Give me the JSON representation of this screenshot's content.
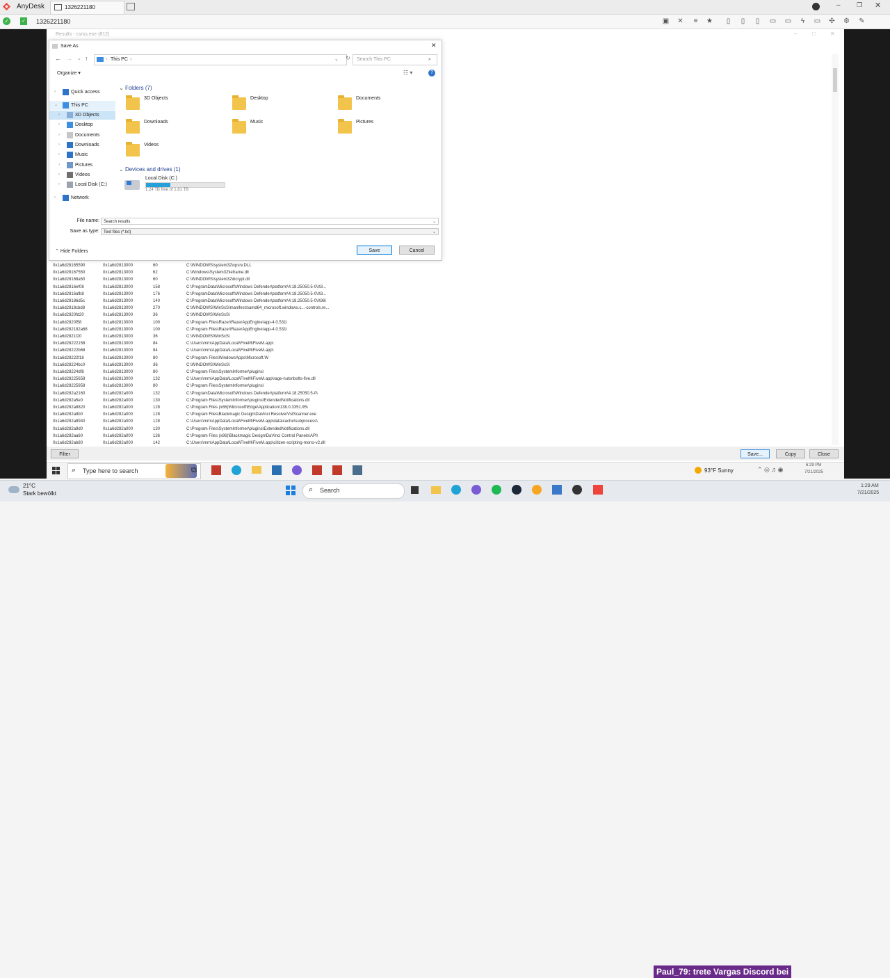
{
  "anydesk": {
    "app_name": "AnyDesk",
    "tab_label": "1326221180",
    "address_label": "1326221180",
    "brand_color": "#ef443b"
  },
  "results_window": {
    "title": "Results - csrss.exe (812)",
    "rows": [
      [
        "0x1a6d28165590",
        "0x1a6d2813000",
        "60",
        "C:\\WINDOWS\\system32\\xpsrv.DLL"
      ],
      [
        "0x1a6d28167550",
        "0x1a6d2813000",
        "62",
        "C:\\Windows\\System32\\ieframe.dll"
      ],
      [
        "0x1a6d28168a50",
        "0x1a6d2813000",
        "60",
        "C:\\WINDOWS\\system32\\bcrypt.dll"
      ],
      [
        "0x1a6d2816ef08",
        "0x1a6d2813000",
        "158",
        "C:\\ProgramData\\Microsoft\\Windows Defender\\platform\\4.18.25050.5-0\\X8..."
      ],
      [
        "0x1a6d2816afb8",
        "0x1a6d2813000",
        "176",
        "C:\\ProgramData\\Microsoft\\Windows Defender\\platform\\4.18.25050.5-0\\X8..."
      ],
      [
        "0x1a6d28186d5c",
        "0x1a6d2813000",
        "140",
        "C:\\ProgramData\\Microsoft\\Windows Defender\\platform\\4.18.25050.5-0\\X86\\"
      ],
      [
        "0x1a6d2818cbd8",
        "0x1a6d2813000",
        "270",
        "C:\\WINDOWS\\WinSxS\\manifests\\amd64_microsoft.windows.c...-controls.re..."
      ],
      [
        "0x1a6d2820fd20",
        "0x1a6d2813000",
        "36",
        "C:\\WINDOWS\\WinSxS\\"
      ],
      [
        "0x1a6d2820f58",
        "0x1a6d2813000",
        "100",
        "C:\\Program Files\\Razer\\RazerAppEngine\\app-4.0.531\\"
      ],
      [
        "0x1a6d282182a68",
        "0x1a6d2813000",
        "100",
        "C:\\Program Files\\Razer\\RazerAppEngine\\app-4.0.531\\"
      ],
      [
        "0x1a6d2821f20",
        "0x1a6d2813000",
        "36",
        "C:\\WINDOWS\\WinSxS\\"
      ],
      [
        "0x1a6d28222158",
        "0x1a6d2813000",
        "84",
        "C:\\Users\\mm\\AppData\\Local\\FiveM\\FiveM.app\\"
      ],
      [
        "0x1a6d28222b68",
        "0x1a6d2813000",
        "84",
        "C:\\Users\\mm\\AppData\\Local\\FiveM\\FiveM.app\\"
      ],
      [
        "0x1a6d28222f18",
        "0x1a6d2813000",
        "80",
        "C:\\Program Files\\WindowsApps\\Microsoft.W"
      ],
      [
        "0x1a6d28224bc0",
        "0x1a6d2813000",
        "36",
        "C:\\WINDOWS\\WinSxS\\"
      ],
      [
        "0x1a6d28224df8",
        "0x1a6d2813000",
        "80",
        "C:\\Program Files\\SystemInformer\\plugins\\"
      ],
      [
        "0x1a6d28225658",
        "0x1a6d2813000",
        "132",
        "C:\\Users\\mm\\AppData\\Local\\FiveM\\FiveM.app\\rage-nutsnbolts-five.dll"
      ],
      [
        "0x1a6d28225958",
        "0x1a6d2813000",
        "80",
        "C:\\Program Files\\SystemInformer\\plugins\\"
      ],
      [
        "0x1a6d282a2160",
        "0x1a6d282a000",
        "132",
        "C:\\ProgramData\\Microsoft\\Windows Defender\\platform\\4.18.25050.5-0\\"
      ],
      [
        "0x1a6d282a5e0",
        "0x1a6d282a000",
        "130",
        "C:\\Program Files\\SystemInformer\\plugins\\ExtendedNotifications.dll"
      ],
      [
        "0x1a6d282a8820",
        "0x1a6d282a000",
        "128",
        "C:\\Program Files (x86)\\Microsoft\\Edge\\Application\\138.0.3351.95\\"
      ],
      [
        "0x1a6d282a8b0",
        "0x1a6d282a000",
        "128",
        "C:\\Program Files\\Blackmagic Design\\DaVinci Resolve\\VstScanner.exe"
      ],
      [
        "0x1a6d282a8940",
        "0x1a6d282a000",
        "128",
        "C:\\Users\\mm\\AppData\\Local\\FiveM\\FiveM.app\\data\\cache\\subprocess\\"
      ],
      [
        "0x1a6d282a9d0",
        "0x1a6d282a000",
        "130",
        "C:\\Program Files\\SystemInformer\\plugins\\ExtendedNotifications.dll"
      ],
      [
        "0x1a6d282aa60",
        "0x1a6d282a000",
        "136",
        "C:\\Program Files (x86)\\Blackmagic Design\\DaVinci Control Panels\\API\\"
      ],
      [
        "0x1a6d282ab80",
        "0x1a6d282a000",
        "142",
        "C:\\Users\\mm\\AppData\\Local\\FiveM\\FiveM.app\\citizen-scripting-mono-v2.dll"
      ]
    ],
    "buttons": {
      "filter": "Filter",
      "save": "Save...",
      "copy": "Copy",
      "close": "Close"
    }
  },
  "dialog": {
    "title": "Save As",
    "breadcrumb": "This PC",
    "search_placeholder": "Search This PC",
    "organize": "Organize",
    "nav": [
      {
        "label": "Quick access",
        "icon": "star-icon"
      },
      {
        "label": "This PC",
        "icon": "computer-icon"
      },
      {
        "label": "3D Objects",
        "icon": "cube-icon"
      },
      {
        "label": "Desktop",
        "icon": "desktop-icon"
      },
      {
        "label": "Documents",
        "icon": "document-icon"
      },
      {
        "label": "Downloads",
        "icon": "download-icon"
      },
      {
        "label": "Music",
        "icon": "music-icon"
      },
      {
        "label": "Pictures",
        "icon": "picture-icon"
      },
      {
        "label": "Videos",
        "icon": "video-icon"
      },
      {
        "label": "Local Disk (C:)",
        "icon": "drive-icon"
      },
      {
        "label": "Network",
        "icon": "network-icon"
      }
    ],
    "folders_header": "Folders (7)",
    "folders": [
      "3D Objects",
      "Desktop",
      "Documents",
      "Downloads",
      "Music",
      "Pictures",
      "Videos"
    ],
    "drives_header": "Devices and drives (1)",
    "drive": {
      "name": "Local Disk (C:)",
      "free": "1.24 TB free of 1.81 TB",
      "used_fraction": 0.31
    },
    "file_name_label": "File name:",
    "file_name_value": "Search results",
    "save_type_label": "Save as type:",
    "save_type_value": "Text files (*.txt)",
    "hide_folders": "Hide Folders",
    "save": "Save",
    "cancel": "Cancel"
  },
  "remote_taskbar": {
    "search_placeholder": "Type here to search",
    "weather": "93°F Sunny",
    "time": "6:29 PM",
    "date": "7/21/2025"
  },
  "local_taskbar": {
    "weather_temp": "21°C",
    "weather_desc": "Stark bewölkt",
    "search": "Search",
    "streamer_name": "Paul_79",
    "streamer_msg": ": trete Vargas Discord bei",
    "time": "1:29 AM",
    "date": "7/21/2025"
  }
}
